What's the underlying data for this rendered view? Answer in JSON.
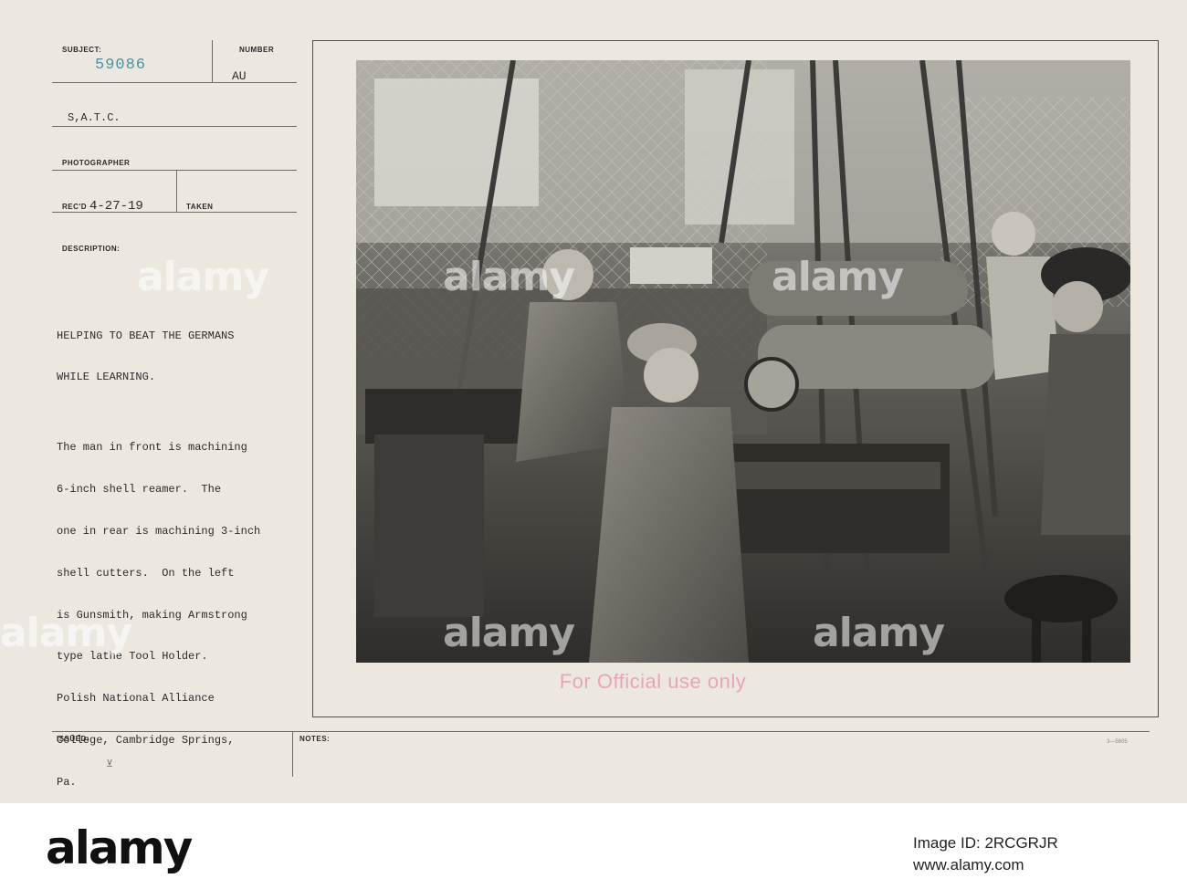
{
  "card": {
    "labels": {
      "subject": "SUBJECT:",
      "number": "NUMBER",
      "photographer": "PHOTOGRAPHER",
      "recd": "REC'D",
      "taken": "TAKEN",
      "description": "DESCRIPTION:",
      "issued": "ISSUED:",
      "notes": "NOTES:"
    },
    "subject_number": "59086",
    "number_value": "AU",
    "unit": "S,A.T.C.",
    "recd_date": "4-27-19",
    "description_lines": [
      "HELPING TO BEAT THE GERMANS",
      "WHILE LEARNING.",
      "",
      "The man in front is machining",
      "6-inch shell reamer.  The",
      "one in rear is machining 3-inch",
      "shell cutters.  On the left",
      "is Gunsmith, making Armstrong",
      "type lathe Tool Holder.",
      "Polish National Alliance",
      "College, Cambridge Springs,",
      "Pa."
    ],
    "official_stamp": "For Official use only",
    "form_code": "3—5605",
    "issued_mark": "⊻"
  },
  "watermark": {
    "text": "alamy"
  },
  "footer": {
    "logo": "alamy",
    "image_id_label": "Image ID:",
    "image_id": "2RCGRJR",
    "site": "www.alamy.com"
  },
  "colors": {
    "card_paper": "#ece8df",
    "stamp_blue": "#4f8fa0",
    "official_pink": "#e6a6b4"
  }
}
